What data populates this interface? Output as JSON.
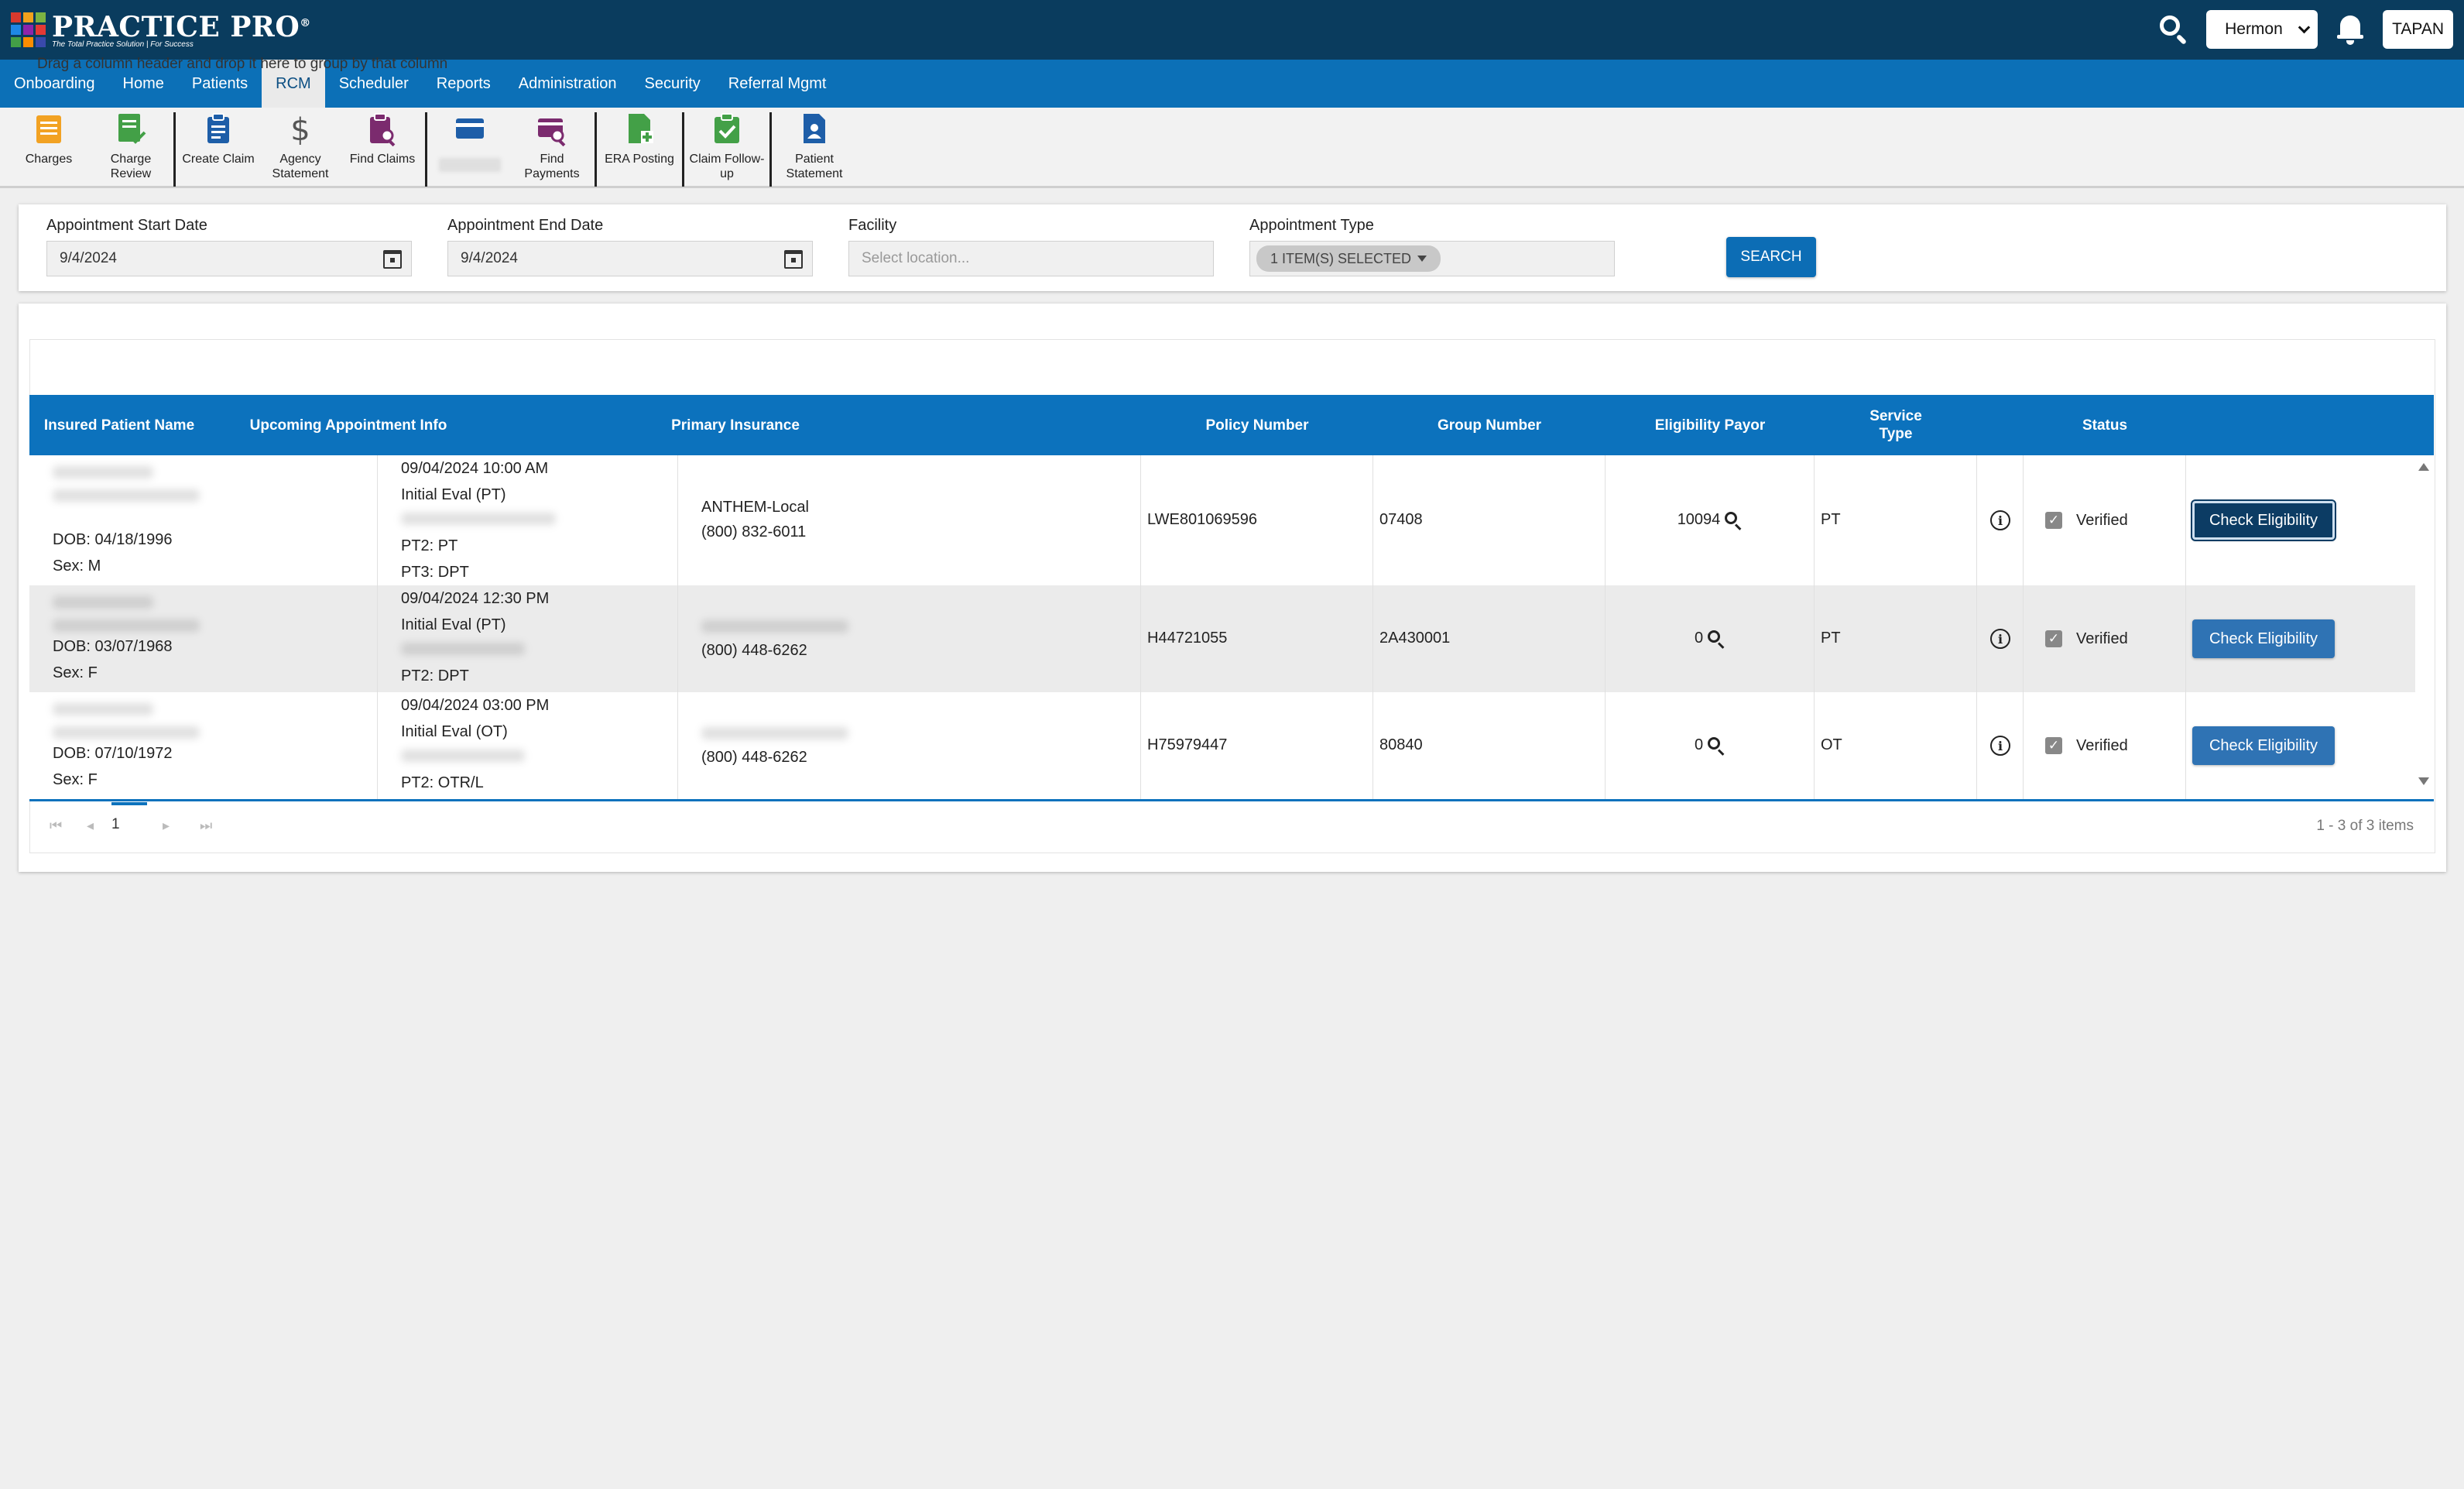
{
  "app": {
    "logo_name": "PRACTICE PRO",
    "logo_reg": "®",
    "logo_tagline": "The Total Practice Solution | For Success",
    "logo_colors": [
      "#d83a2e",
      "#f3a11c",
      "#7cb342",
      "#1e88e5",
      "#8e24aa",
      "#e53935",
      "#43a047",
      "#fb8c00",
      "#3949ab"
    ]
  },
  "topbar": {
    "facility_selected": "Hermon",
    "user_label": "TAPAN"
  },
  "nav": {
    "items": [
      "Onboarding",
      "Home",
      "Patients",
      "RCM",
      "Scheduler",
      "Reports",
      "Administration",
      "Security",
      "Referral Mgmt"
    ],
    "active": "RCM"
  },
  "toolbar": {
    "groups": [
      [
        {
          "label": "Charges",
          "icon": "charges-icon",
          "color": "#f2a223"
        },
        {
          "label": "Charge Review",
          "icon": "charge-review-icon",
          "color": "#43a047"
        }
      ],
      [
        {
          "label": "Create Claim",
          "icon": "create-claim-icon",
          "color": "#1e5ea8"
        },
        {
          "label": "Agency Statement",
          "icon": "dollar-icon",
          "color": "#555555"
        },
        {
          "label": "Find Claims",
          "icon": "find-claims-icon",
          "color": "#7b2b6e"
        }
      ],
      [
        {
          "label": "",
          "icon": "card-icon",
          "color": "#1e5ea8",
          "blurred": true
        },
        {
          "label": "Find Payments",
          "icon": "find-payments-icon",
          "color": "#7b2b6e"
        }
      ],
      [
        {
          "label": "ERA Posting",
          "icon": "era-posting-icon",
          "color": "#43a047"
        }
      ],
      [
        {
          "label": "Claim Follow-up",
          "icon": "claim-followup-icon",
          "color": "#43a047"
        }
      ],
      [
        {
          "label": "Patient Statement",
          "icon": "patient-statement-icon",
          "color": "#1e5ea8"
        }
      ]
    ]
  },
  "filters": {
    "start_label": "Appointment Start Date",
    "start_value": "9/4/2024",
    "end_label": "Appointment End Date",
    "end_value": "9/4/2024",
    "facility_label": "Facility",
    "facility_placeholder": "Select location...",
    "type_label": "Appointment Type",
    "type_chip": "1 ITEM(S) SELECTED",
    "search_label": "SEARCH"
  },
  "grid": {
    "group_hint": "Drag a column header and drop it here to group by that column",
    "columns": {
      "patient": "Insured Patient Name",
      "appointment": "Upcoming Appointment Info",
      "insurance": "Primary Insurance",
      "policy": "Policy Number",
      "group": "Group Number",
      "payor": "Eligibility Payor",
      "service": "Service Type",
      "status": "Status"
    },
    "rows": [
      {
        "dob": "DOB: 04/18/1996",
        "sex": "Sex: M",
        "appt_time": "09/04/2024 10:00 AM",
        "appt_type": "Initial Eval (PT)",
        "appt_line3": "PT2: PT",
        "appt_line4": "PT3: DPT",
        "insurance_name": "ANTHEM-Local",
        "insurance_phone": "(800) 832-6011",
        "policy": "LWE801069596",
        "group": "07408",
        "payor": "10094",
        "service": "PT",
        "status": "Verified",
        "action": "Check Eligibility"
      },
      {
        "dob": "DOB: 03/07/1968",
        "sex": "Sex: F",
        "appt_time": "09/04/2024 12:30 PM",
        "appt_type": "Initial Eval (PT)",
        "appt_line3": "PT2: DPT",
        "insurance_phone": "(800) 448-6262",
        "policy": "H44721055",
        "group": "2A430001",
        "payor": "0",
        "service": "PT",
        "status": "Verified",
        "action": "Check Eligibility"
      },
      {
        "dob": "DOB: 07/10/1972",
        "sex": "Sex: F",
        "appt_time": "09/04/2024 03:00 PM",
        "appt_type": "Initial Eval (OT)",
        "appt_line3": "PT2: OTR/L",
        "insurance_phone": "(800) 448-6262",
        "policy": "H75979447",
        "group": "80840",
        "payor": "0",
        "service": "OT",
        "status": "Verified",
        "action": "Check Eligibility"
      }
    ],
    "pager": {
      "current_page": "1",
      "info": "1 - 3 of 3 items"
    }
  }
}
